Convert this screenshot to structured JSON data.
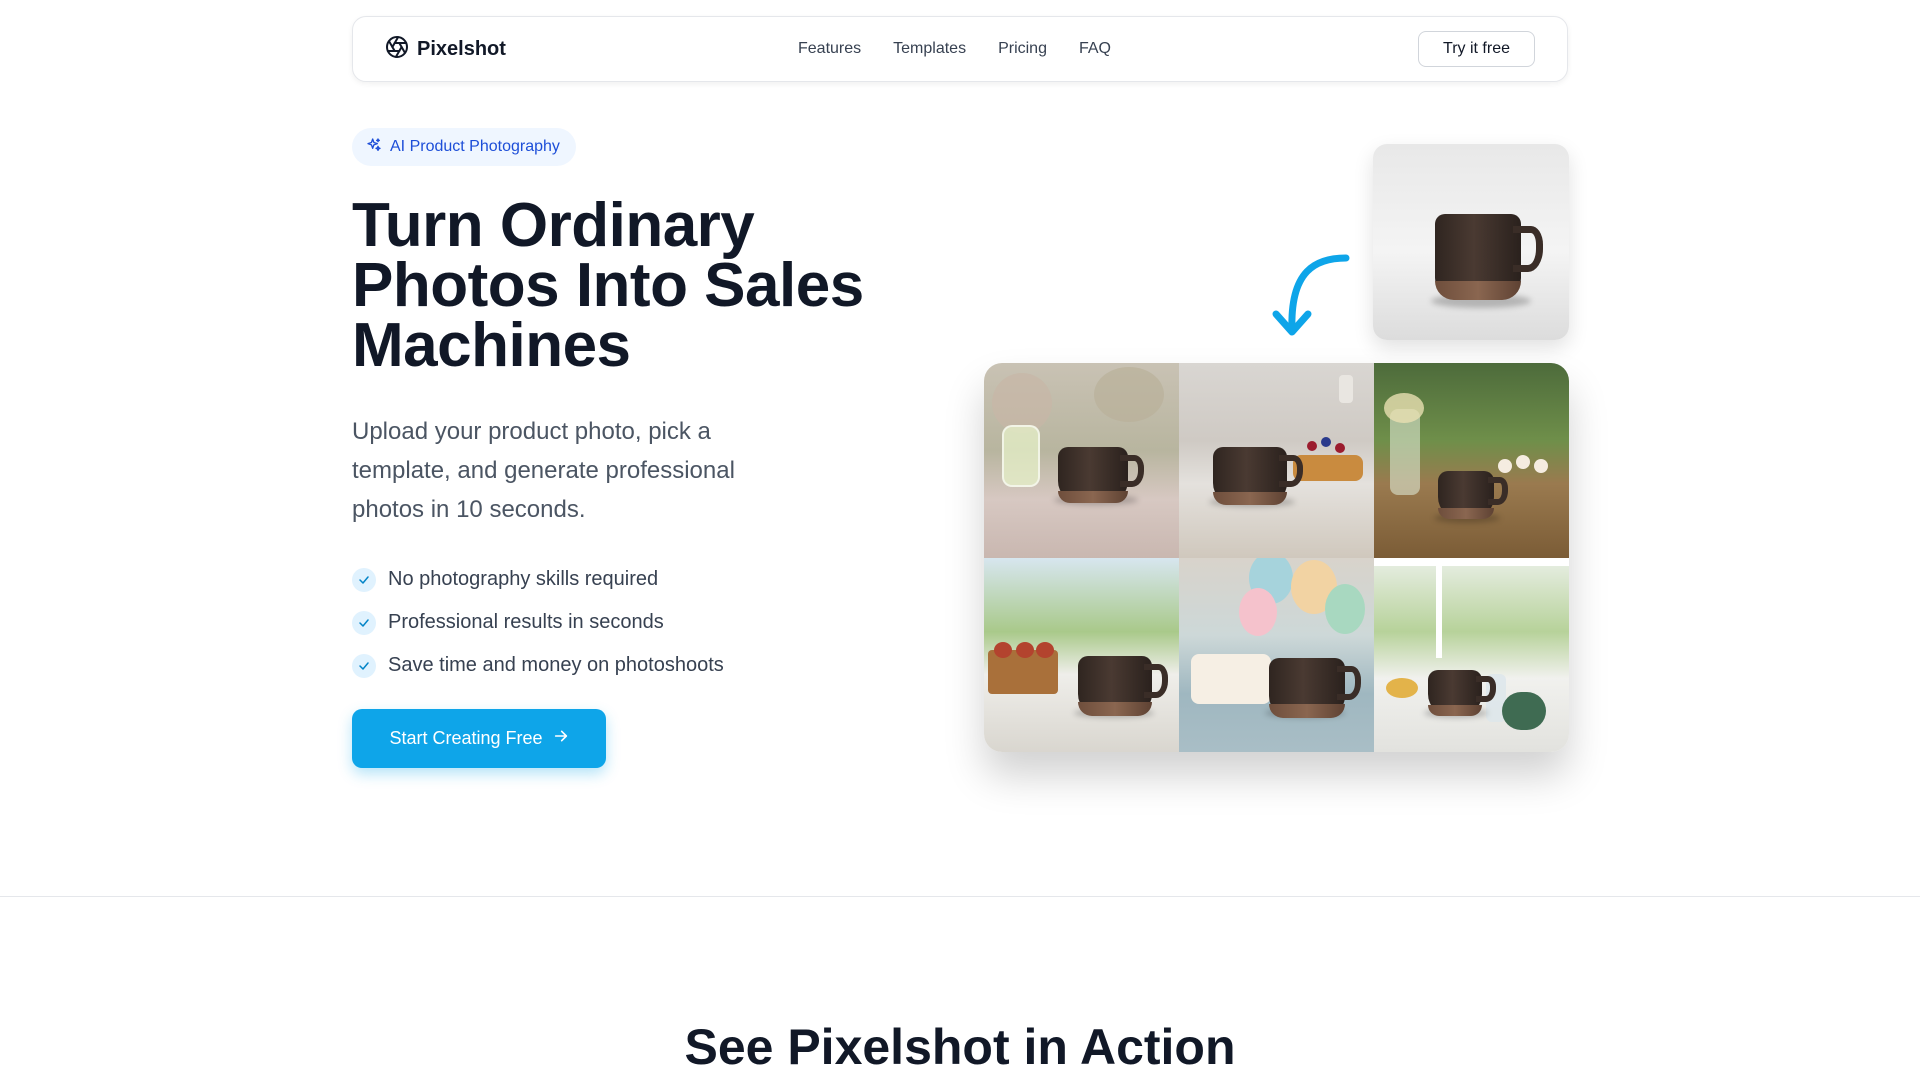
{
  "nav": {
    "brand": "Pixelshot",
    "links": [
      "Features",
      "Templates",
      "Pricing",
      "FAQ"
    ],
    "cta": "Try it free"
  },
  "hero": {
    "badge": "AI Product Photography",
    "headline_lines": [
      "Turn Ordinary",
      "Photos Into Sales",
      "Machines"
    ],
    "subtitle_lines": [
      "Upload your product photo, pick a",
      "template, and generate professional",
      "photos in 10 seconds."
    ],
    "features": [
      "No photography skills required",
      "Professional results in seconds",
      "Save time and money on photoshoots"
    ],
    "cta_label": "Start Creating Free"
  },
  "showcase": {
    "source_alt": "mug-product-photo",
    "templates": [
      "garden-picnic",
      "kitchen-waffles",
      "outdoor-picnic-table",
      "patio-muffins",
      "birthday-balloons",
      "sunroom-fitness"
    ]
  },
  "section": {
    "title": "See Pixelshot in Action"
  },
  "colors": {
    "accent": "#0ea5e9",
    "badge_text": "#1d4ed8",
    "heading": "#111827"
  }
}
